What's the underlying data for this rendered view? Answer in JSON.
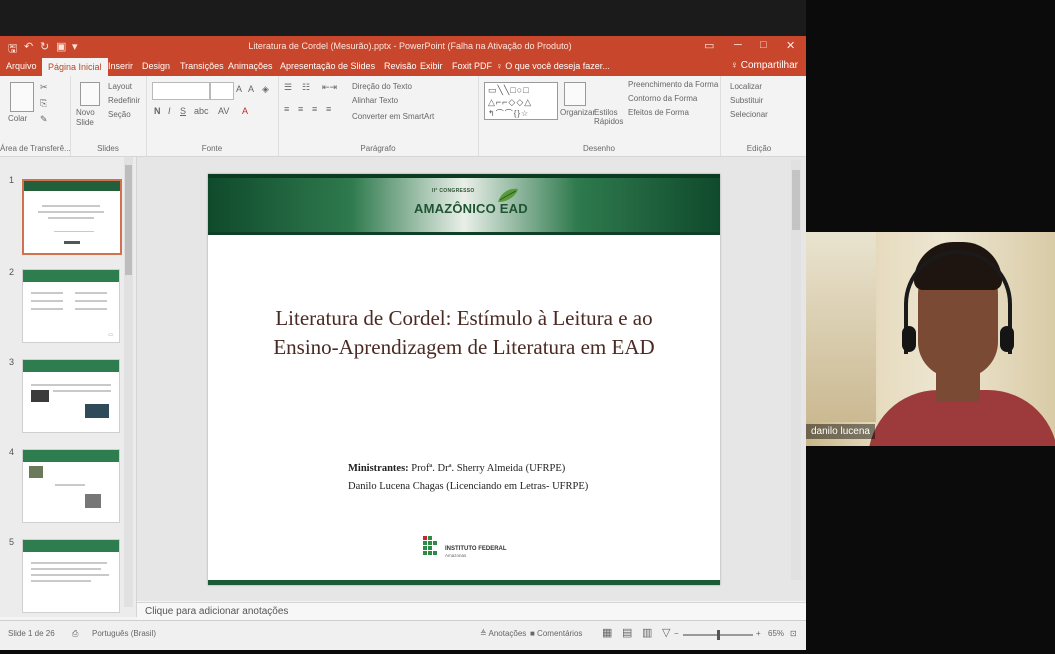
{
  "titlebar": {
    "doc_title": "Literatura de Cordel (Mesurão).pptx - PowerPoint (Falha na Ativação do Produto)",
    "minimize": "─",
    "restore": "□",
    "close": "✕"
  },
  "tabs": [
    "Arquivo",
    "Página Inicial",
    "Inserir",
    "Design",
    "Transições",
    "Animações",
    "Apresentação de Slides",
    "Revisão",
    "Exibir",
    "Foxit PDF",
    "♀ O que você deseja fazer..."
  ],
  "share_label": "♀ Compartilhar",
  "ribbon": {
    "groups": [
      {
        "label": "Área de Transferê...",
        "items": [
          "Colar"
        ]
      },
      {
        "label": "Slides",
        "items": [
          "Novo Slide",
          "Layout",
          "Redefinir",
          "Seção"
        ]
      },
      {
        "label": "Fonte",
        "items": [
          "N",
          "I",
          "S",
          "abc",
          "AV",
          "A"
        ]
      },
      {
        "label": "Parágrafo",
        "items": [
          "Direção do Texto",
          "Alinhar Texto",
          "Converter em SmartArt"
        ]
      },
      {
        "label": "Desenho",
        "items": [
          "Organizar",
          "Estilos Rápidos",
          "Preenchimento da Forma",
          "Contorno da Forma",
          "Efeitos de Forma"
        ]
      },
      {
        "label": "Edição",
        "items": [
          "Localizar",
          "Substituir",
          "Selecionar"
        ]
      }
    ]
  },
  "thumbnails": [
    {
      "num": "1",
      "selected": true
    },
    {
      "num": "2",
      "selected": false
    },
    {
      "num": "3",
      "selected": false
    },
    {
      "num": "4",
      "selected": false
    },
    {
      "num": "5",
      "selected": false
    }
  ],
  "slide": {
    "logo_small": "II° CONGRESSO",
    "logo_main": "AMAZÔNICO EAD",
    "title": "Literatura de Cordel: Estímulo à Leitura e ao Ensino-Aprendizagem de Literatura em EAD",
    "presenters_label": "Ministrantes:",
    "presenter_1": "Profª. Drª. Sherry Almeida (UFRPE)",
    "presenter_2": "Danilo Lucena Chagas (Licenciando em Letras- UFRPE)",
    "if_name": "INSTITUTO FEDERAL",
    "if_sub": "Amazonas"
  },
  "notes_placeholder": "Clique para adicionar anotações",
  "statusbar": {
    "slide_count": "Slide 1 de 26",
    "language": "Português (Brasil)",
    "notes_btn": "≜ Anotações",
    "comments_btn": "■ Comentários",
    "zoom": "65%"
  },
  "webcam": {
    "name": "danilo lucena"
  },
  "colors": {
    "accent": "#c8462b",
    "slide_green": "#1f5433",
    "title_brown": "#4a2a22"
  }
}
